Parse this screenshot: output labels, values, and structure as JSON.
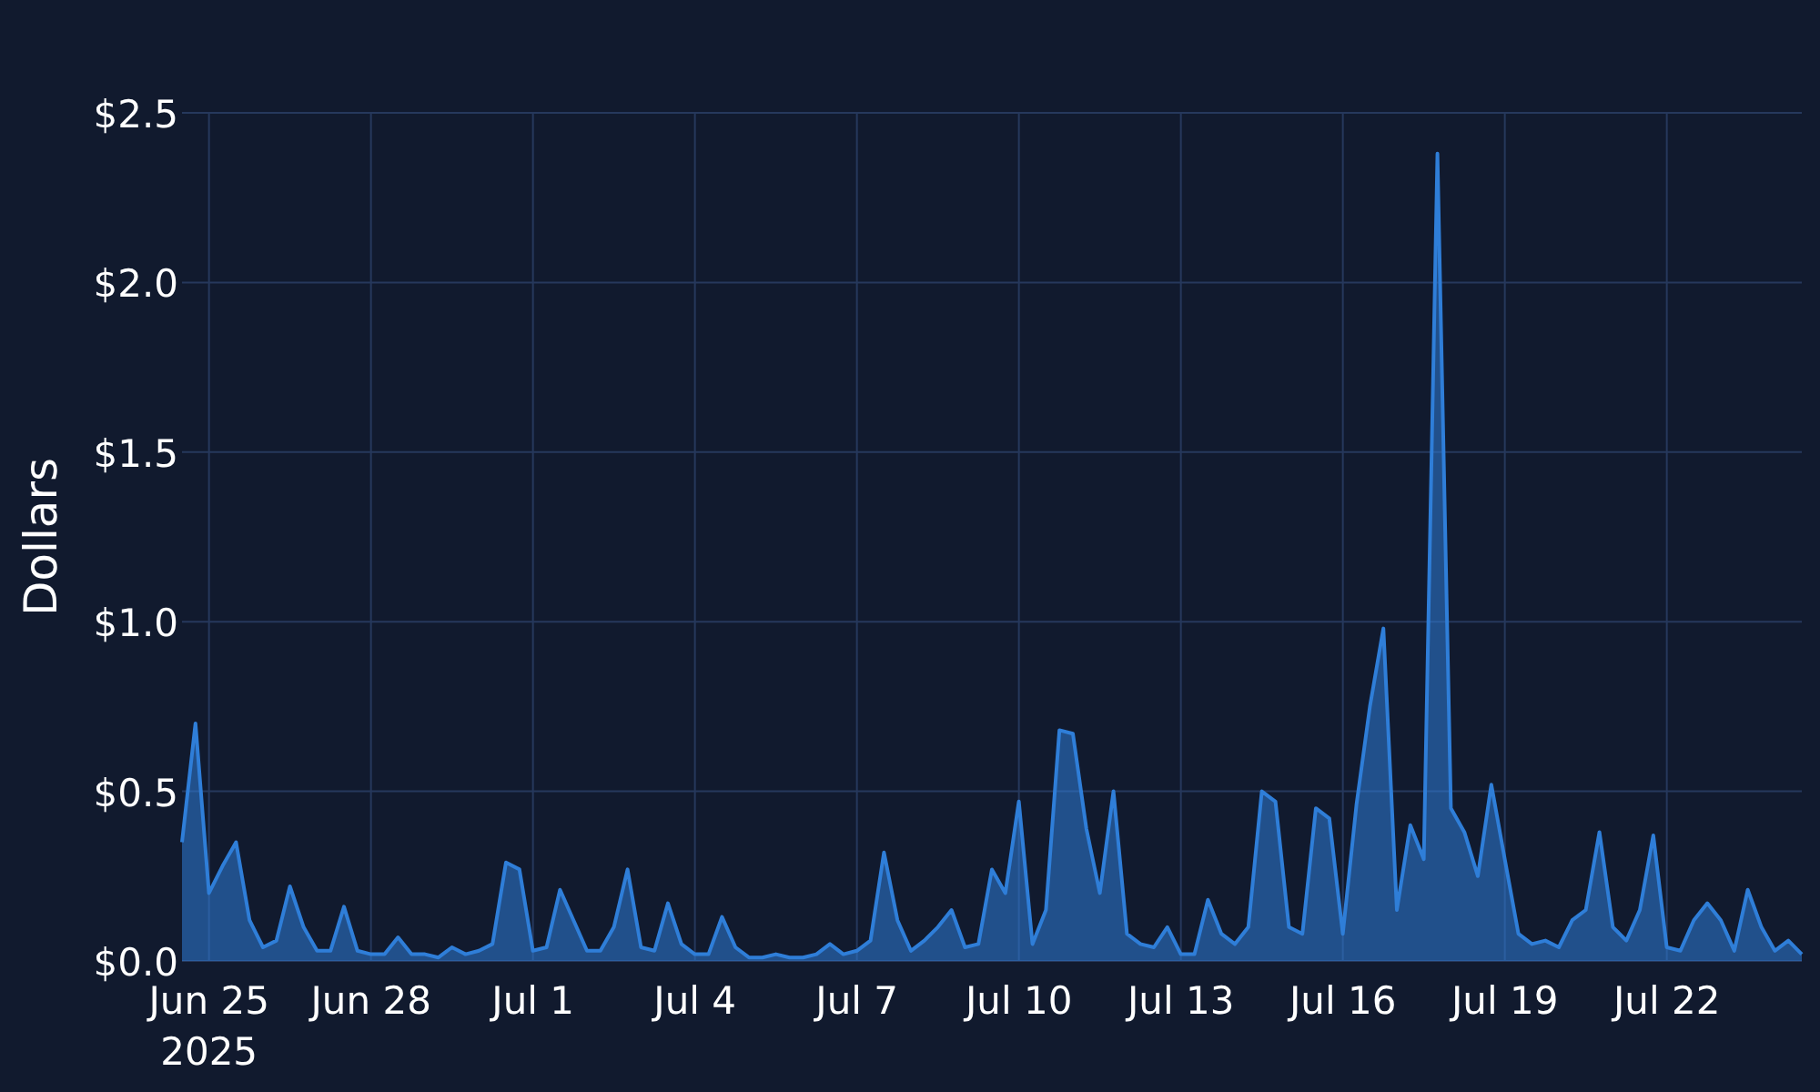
{
  "chart_data": {
    "type": "area",
    "grid": true,
    "ylabel": "Dollars",
    "ylim": [
      0,
      2.5
    ],
    "yticks": [
      {
        "value": 0,
        "label": "$0.0"
      },
      {
        "value": 0.5,
        "label": "$0.5"
      },
      {
        "value": 1,
        "label": "$1.0"
      },
      {
        "value": 1.5,
        "label": "$1.5"
      },
      {
        "value": 2,
        "label": "$2.0"
      },
      {
        "value": 2.5,
        "label": "$2.5"
      }
    ],
    "categories": [
      null,
      null,
      "Jun 25\n2025",
      null,
      null,
      null,
      null,
      null,
      null,
      null,
      null,
      null,
      null,
      null,
      "Jun 28",
      null,
      null,
      null,
      null,
      null,
      null,
      null,
      null,
      null,
      null,
      null,
      "Jul 1",
      null,
      null,
      null,
      null,
      null,
      null,
      null,
      null,
      null,
      null,
      null,
      "Jul 4",
      null,
      null,
      null,
      null,
      null,
      null,
      null,
      null,
      null,
      null,
      null,
      "Jul 7",
      null,
      null,
      null,
      null,
      null,
      null,
      null,
      null,
      null,
      null,
      null,
      "Jul 10",
      null,
      null,
      null,
      null,
      null,
      null,
      null,
      null,
      null,
      null,
      null,
      "Jul 13",
      null,
      null,
      null,
      null,
      null,
      null,
      null,
      null,
      null,
      null,
      null,
      "Jul 16",
      null,
      null,
      null,
      null,
      null,
      null,
      null,
      null,
      null,
      null,
      null,
      "Jul 19",
      null,
      null,
      null,
      null,
      null,
      null,
      null,
      null,
      null,
      null,
      null,
      "Jul 22",
      null,
      null,
      null,
      null,
      null,
      null,
      null,
      null,
      null,
      null
    ],
    "series": [
      {
        "color": "#2f7ed8",
        "values": [
          0.35,
          0.7,
          0.2,
          0.28,
          0.35,
          0.12,
          0.04,
          0.06,
          0.22,
          0.1,
          0.03,
          0.03,
          0.16,
          0.03,
          0.02,
          0.02,
          0.07,
          0.02,
          0.02,
          0.01,
          0.04,
          0.02,
          0.03,
          0.05,
          0.29,
          0.27,
          0.03,
          0.04,
          0.21,
          0.12,
          0.03,
          0.03,
          0.1,
          0.27,
          0.04,
          0.03,
          0.17,
          0.05,
          0.02,
          0.02,
          0.13,
          0.04,
          0.01,
          0.01,
          0.02,
          0.01,
          0.01,
          0.02,
          0.05,
          0.02,
          0.03,
          0.06,
          0.32,
          0.12,
          0.03,
          0.06,
          0.1,
          0.15,
          0.04,
          0.05,
          0.27,
          0.2,
          0.47,
          0.05,
          0.15,
          0.68,
          0.67,
          0.39,
          0.2,
          0.5,
          0.08,
          0.05,
          0.04,
          0.1,
          0.02,
          0.02,
          0.18,
          0.08,
          0.05,
          0.1,
          0.5,
          0.47,
          0.1,
          0.08,
          0.45,
          0.42,
          0.08,
          0.46,
          0.75,
          0.98,
          0.15,
          0.4,
          0.3,
          2.38,
          0.45,
          0.38,
          0.25,
          0.52,
          0.3,
          0.08,
          0.05,
          0.06,
          0.04,
          0.12,
          0.15,
          0.38,
          0.1,
          0.06,
          0.15,
          0.37,
          0.04,
          0.03,
          0.12,
          0.17,
          0.12,
          0.03,
          0.21,
          0.1,
          0.03,
          0.06,
          0.02
        ]
      }
    ]
  }
}
